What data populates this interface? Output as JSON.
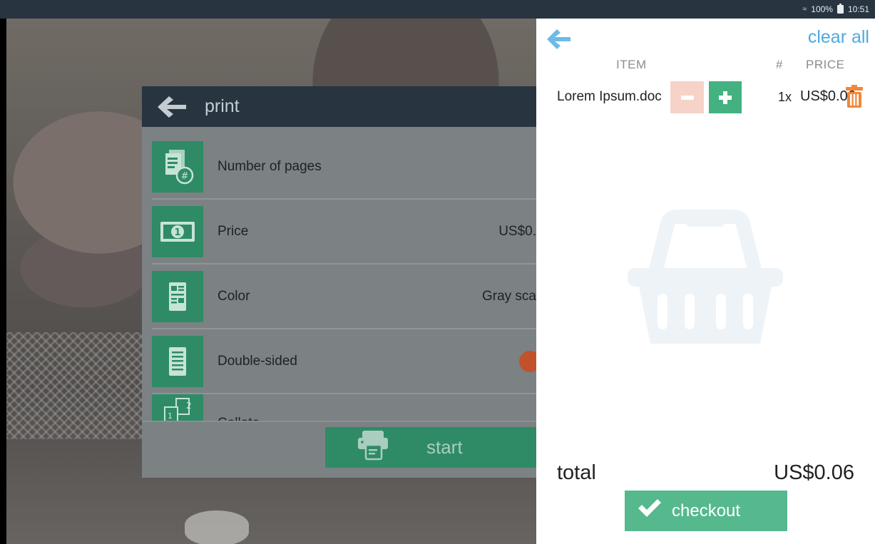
{
  "status_bar": {
    "battery": "100%",
    "time": "10:51"
  },
  "print_dialog": {
    "title": "print",
    "rows": [
      {
        "label": "Number of pages",
        "value": ""
      },
      {
        "label": "Price",
        "value": "US$0."
      },
      {
        "label": "Color",
        "value": "Gray sca"
      },
      {
        "label": "Double-sided",
        "value": ""
      },
      {
        "label": "Collate",
        "value": ""
      }
    ],
    "start_label": "start"
  },
  "cart": {
    "clear_all": "clear all",
    "columns": {
      "item": "ITEM",
      "qty": "#",
      "price": "PRICE"
    },
    "items": [
      {
        "name": "Lorem Ipsum.doc",
        "qty": "1x",
        "price": "US$0.06"
      }
    ],
    "total_label": "total",
    "total_value": "US$0.06",
    "checkout_label": "checkout"
  },
  "colors": {
    "accent_blue": "#4eaadf",
    "green": "#43b180",
    "dark_header": "#283440",
    "trash_orange": "#f0883a"
  }
}
